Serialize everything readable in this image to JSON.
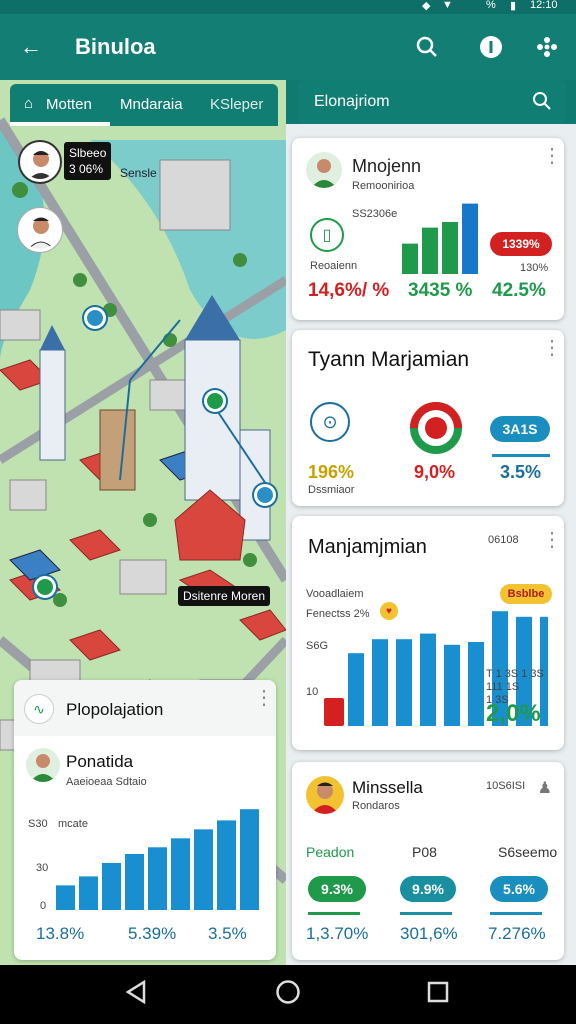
{
  "status": {
    "time": "12:10",
    "battery": "%"
  },
  "appbar": {
    "title": "Binuloa"
  },
  "tabs": [
    {
      "label": "Motten"
    },
    {
      "label": "Mndaraia"
    },
    {
      "label": "KSleper"
    }
  ],
  "right_search": {
    "label": "Elonajriom"
  },
  "map": {
    "user1_label": "Slbeeo\n3 06%",
    "user1_text": "Sensle",
    "place_label": "Dsitenre Moren"
  },
  "card1": {
    "title": "Mnojenn",
    "subtitle": "Remoonirioa",
    "axis_label": "SS2306e",
    "left_label": "Reoaienn",
    "badge": "1339%",
    "right_label": "130%",
    "stats": [
      "14,6%/ %",
      "3435 %",
      "42.5%"
    ],
    "bars": [
      38,
      58,
      65,
      88
    ],
    "colors": {
      "green": "#1e9a4a",
      "blue": "#1777c9",
      "red": "#d32121"
    }
  },
  "card2": {
    "title": "Tyann Marjamian",
    "left_pct": "196%",
    "left_sub": "Dssmiaor",
    "mid_pct": "9,0%",
    "badge": "3A1S",
    "right_pct": "3.5%"
  },
  "card3": {
    "title": "Manjamjmian",
    "code": "06108",
    "line1": "Vooadlaiem",
    "line2": "Fenectss 2%",
    "line3": "S6G",
    "badge": "Bsblbe",
    "tick": "T 1 3S 1 3S\n111 1S\n1 3S",
    "stat": "2,0%",
    "axis": [
      "10",
      "1"
    ],
    "bars": [
      52,
      62,
      62,
      66,
      58,
      60,
      82,
      78,
      78
    ]
  },
  "card4": {
    "title": "Plopolajation",
    "subtitle": "Ponatida",
    "sub2": "Aaeioeaa Sdtaio",
    "ticks": [
      "S30",
      "30",
      "0"
    ],
    "axis_note": "mcate",
    "stats": [
      "13.8%",
      "5.39%",
      "3.5%"
    ],
    "bars": [
      22,
      30,
      42,
      50,
      56,
      64,
      72,
      80,
      90
    ]
  },
  "card5": {
    "title": "Minssella",
    "subtitle": "Rondaros",
    "code": "10S6ISI",
    "cols": [
      "Peadon",
      "P08",
      "S6seemo"
    ],
    "pills": [
      "9.3%",
      "9.9%",
      "5.6%"
    ],
    "stats": [
      "1,3.70%",
      "301,6%",
      "7.276%"
    ]
  }
}
